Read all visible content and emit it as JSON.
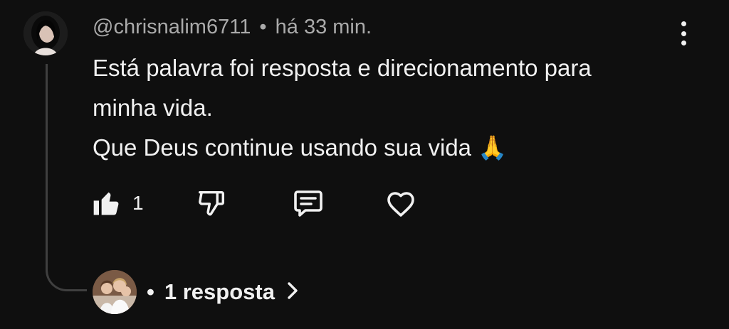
{
  "comment": {
    "author": "@chrisnalim6711",
    "separator": "•",
    "time": "há 33 min.",
    "text_lines": [
      "Está palavra foi resposta e direcionamento para",
      "minha vida.",
      "Que Deus continue usando sua vida 🙏"
    ]
  },
  "actions": {
    "like_count": "1",
    "icons": [
      "thumbs-up-icon",
      "thumbs-down-icon",
      "reply-icon",
      "heart-icon"
    ]
  },
  "replies": {
    "separator": "•",
    "label": "1 resposta",
    "icon": "chevron-right-icon"
  },
  "colors": {
    "background": "#0f0f0f",
    "text": "#f1f1f1",
    "secondary_text": "#aaaaaa",
    "thread_line": "#3f3f3f"
  }
}
